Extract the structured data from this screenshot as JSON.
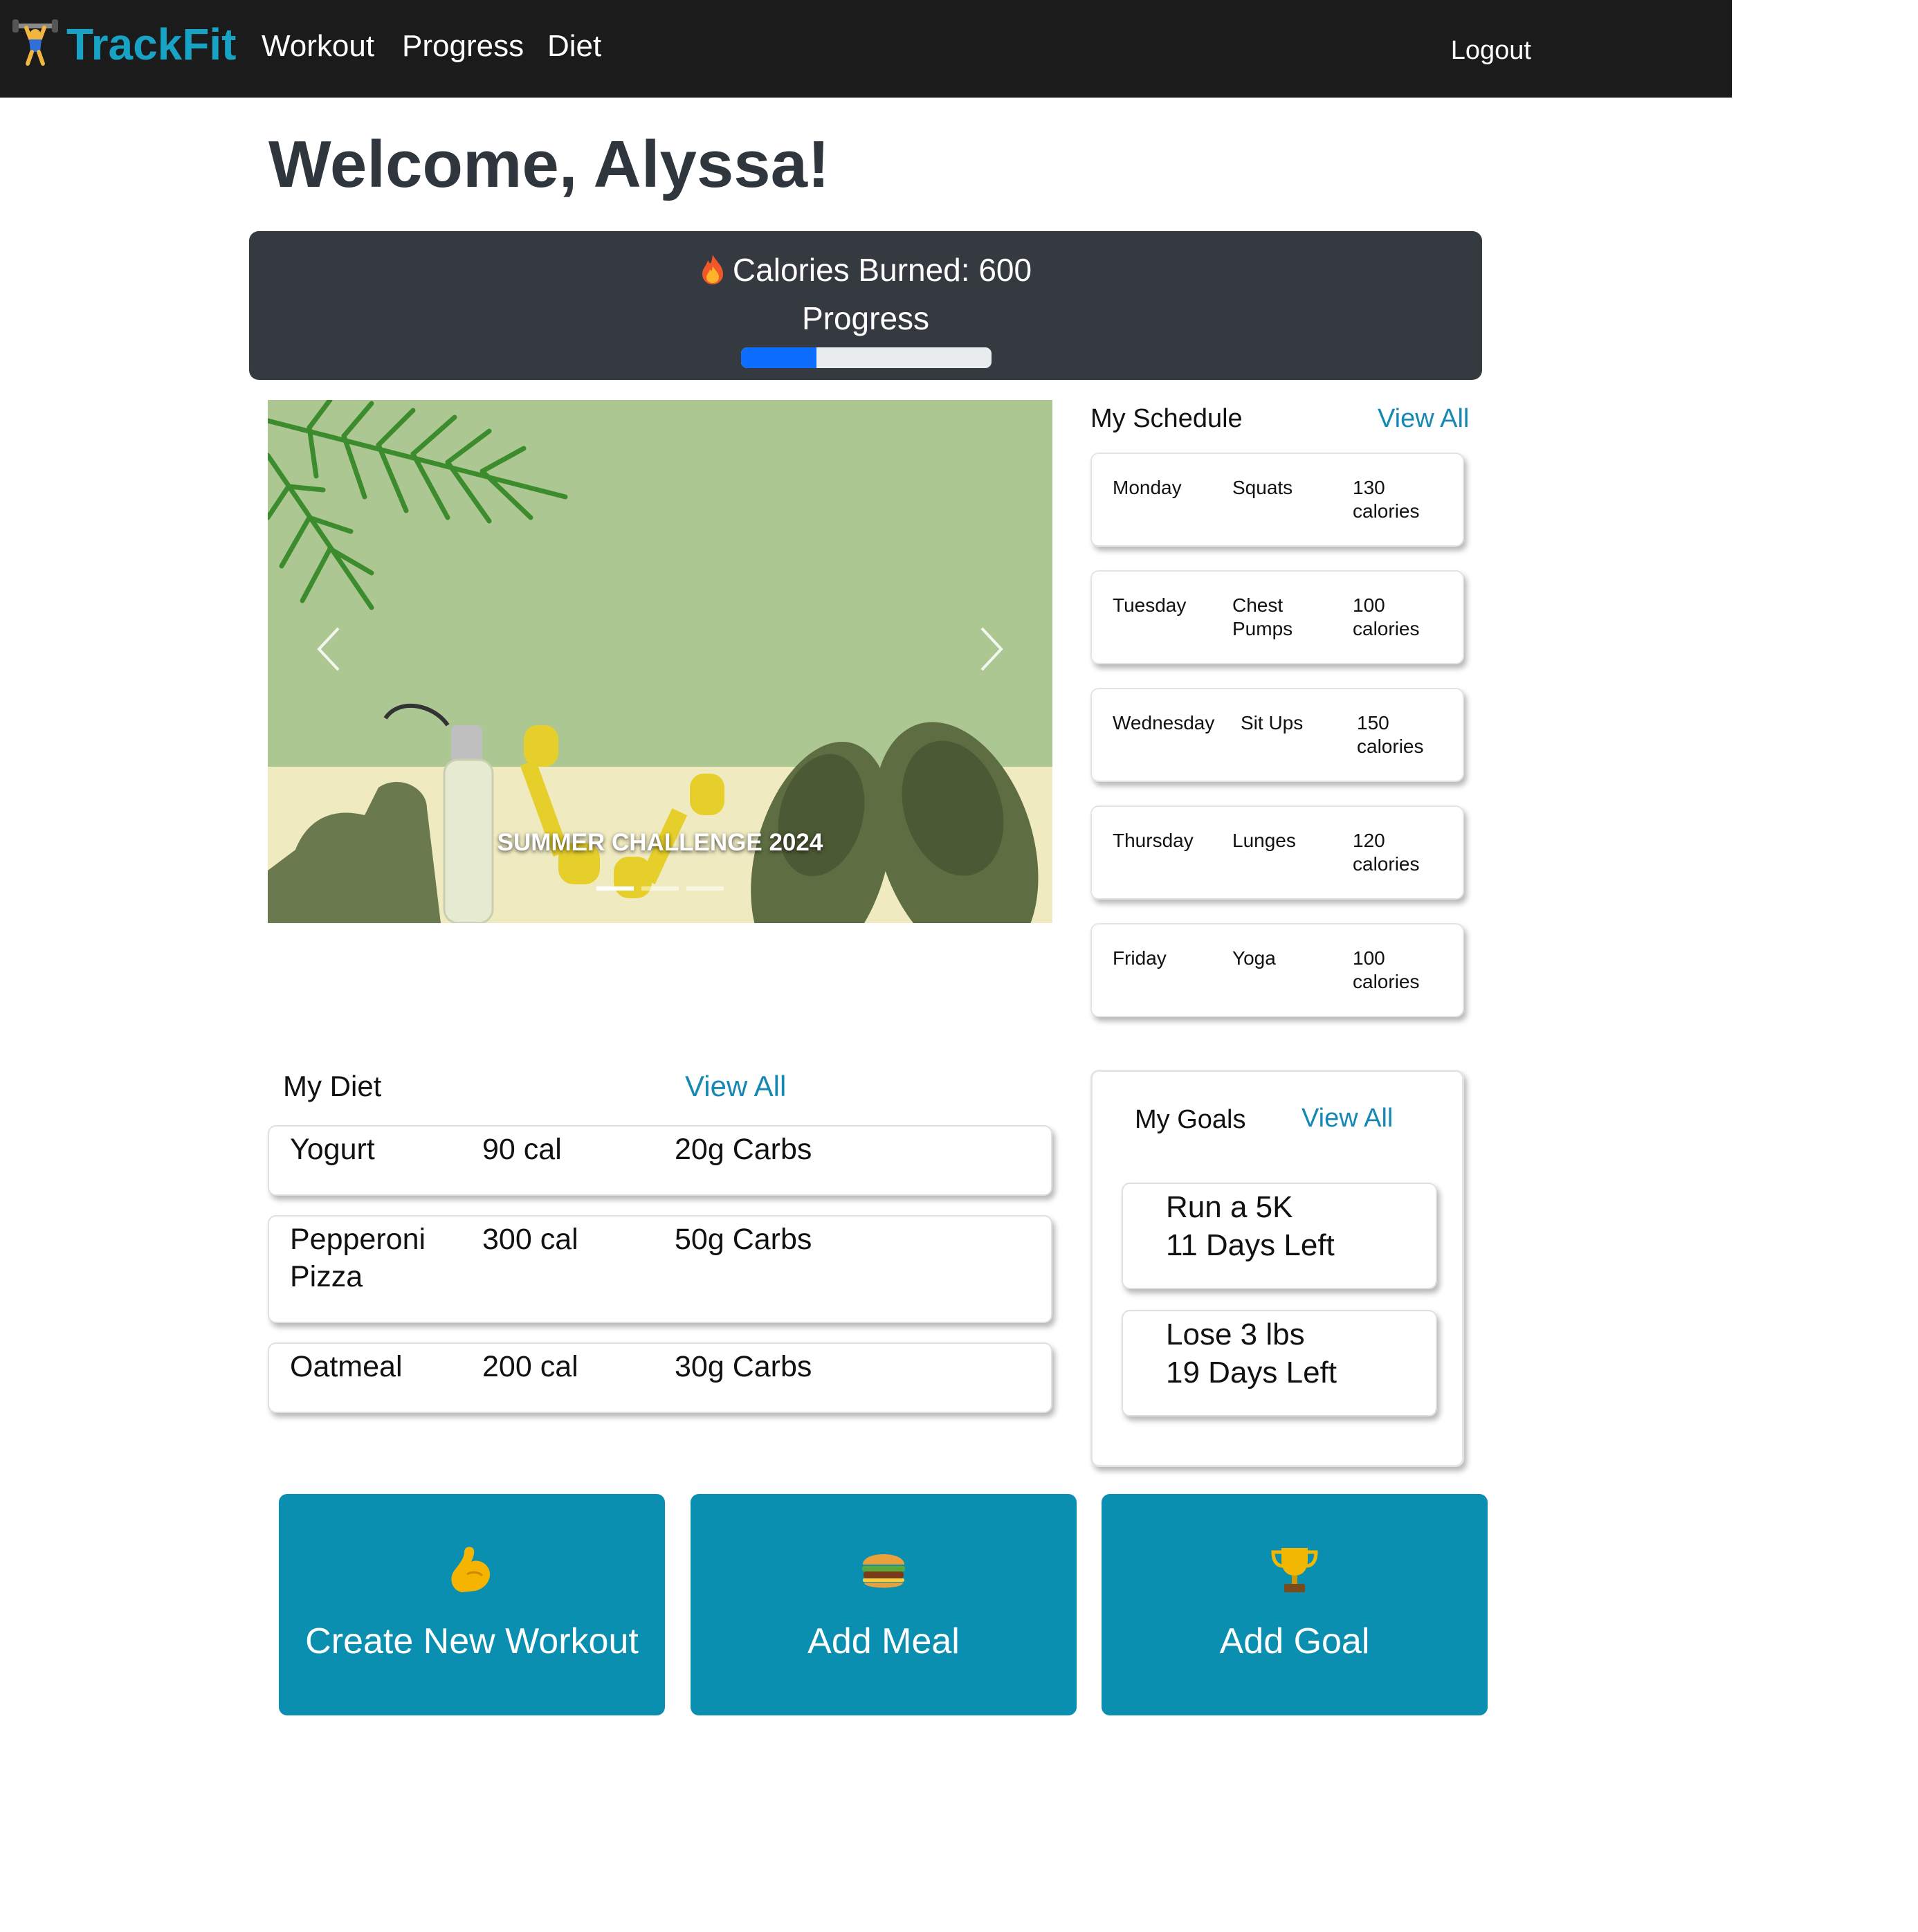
{
  "nav": {
    "brand": "TrackFit",
    "links": [
      "Workout",
      "Progress",
      "Diet"
    ],
    "logout": "Logout"
  },
  "welcome": "Welcome, Alyssa!",
  "stats": {
    "calories_label": "Calories Burned: 600",
    "progress_label": "Progress",
    "progress_value": 0.3
  },
  "carousel": {
    "caption": "SUMMER CHALLENGE 2024",
    "slide_count": 3,
    "active_slide": 1
  },
  "schedule": {
    "title": "My Schedule",
    "view_all": "View All",
    "items": [
      {
        "day": "Monday",
        "exercise": "Squats",
        "cal1": "130",
        "cal2": "calories"
      },
      {
        "day": "Tuesday",
        "exercise": "Chest",
        "exercise2": "Pumps",
        "cal1": "100",
        "cal2": "calories"
      },
      {
        "day": "Wednesday",
        "exercise": "Sit Ups",
        "cal1": "150",
        "cal2": "calories"
      },
      {
        "day": "Thursday",
        "exercise": "Lunges",
        "cal1": "120",
        "cal2": "calories"
      },
      {
        "day": "Friday",
        "exercise": "Yoga",
        "cal1": "100",
        "cal2": "calories"
      }
    ]
  },
  "diet": {
    "title": "My Diet",
    "view_all": "View All",
    "items": [
      {
        "food": "Yogurt",
        "cal": "90 cal",
        "carbs": "20g Carbs"
      },
      {
        "food": "Pepperoni",
        "food2": "Pizza",
        "cal": "300 cal",
        "carbs": "50g Carbs"
      },
      {
        "food": "Oatmeal",
        "cal": "200 cal",
        "carbs": "30g Carbs"
      }
    ]
  },
  "goals": {
    "title": "My Goals",
    "view_all": "View All",
    "items": [
      {
        "name": "Run a 5K",
        "days": "11 Days Left"
      },
      {
        "name": "Lose 3 lbs",
        "days": "19 Days Left"
      }
    ]
  },
  "actions": [
    {
      "label": "Create New Workout",
      "icon": "flexed-biceps-icon"
    },
    {
      "label": "Add Meal",
      "icon": "burger-icon"
    },
    {
      "label": "Add Goal",
      "icon": "trophy-icon"
    }
  ],
  "colors": {
    "brand": "#18a2c4",
    "navbar": "#1b1b1b",
    "banner": "#353a41",
    "progress": "#0d6efd",
    "link": "#1588b4",
    "action": "#0b8fb1"
  }
}
